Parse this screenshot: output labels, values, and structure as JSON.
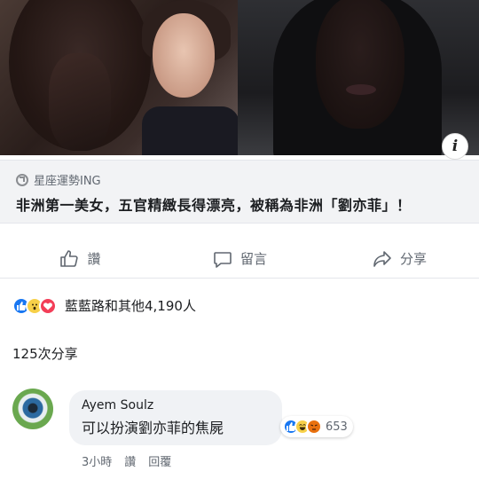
{
  "link_preview": {
    "source": "星座運勢ING",
    "headline": "非洲第一美女，五官精緻長得漂亮，被稱為非洲「劉亦菲」！",
    "info_icon": "i"
  },
  "actions": {
    "like": "讚",
    "comment": "留言",
    "share": "分享"
  },
  "reactions_summary": {
    "icons": [
      "like",
      "wow",
      "love"
    ],
    "text": "藍藍路和其他4,190人"
  },
  "shares_text": "125次分享",
  "comment": {
    "author": "Ayem Soulz",
    "text": "可以扮演劉亦菲的焦屍",
    "reaction_icons": [
      "like",
      "haha",
      "angry"
    ],
    "reaction_count": "653",
    "time": "3小時",
    "like_label": "讚",
    "reply_label": "回覆"
  },
  "colors": {
    "accent": "#1877f2",
    "text_secondary": "#606770",
    "bubble": "#f0f2f5"
  }
}
